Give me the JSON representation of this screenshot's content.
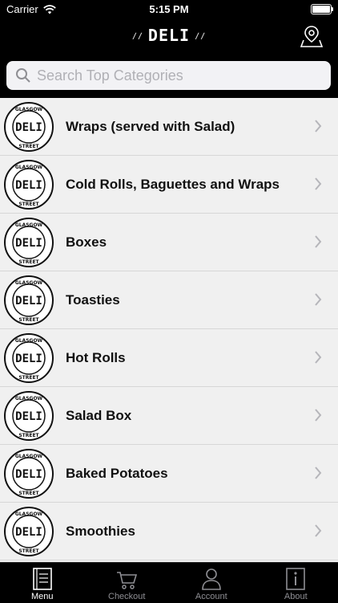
{
  "status_bar": {
    "carrier": "Carrier",
    "time": "5:15 PM"
  },
  "header": {
    "logo_text": "DELI",
    "map_icon": "map-pin-icon"
  },
  "search": {
    "placeholder": "Search Top Categories"
  },
  "badge": {
    "top_text": "GLASGOW",
    "center_text": "DELI",
    "bottom_text": "STREET"
  },
  "categories": [
    {
      "label": "Wraps (served with Salad)"
    },
    {
      "label": "Cold Rolls, Baguettes and Wraps"
    },
    {
      "label": "Boxes"
    },
    {
      "label": "Toasties"
    },
    {
      "label": "Hot Rolls"
    },
    {
      "label": "Salad Box"
    },
    {
      "label": "Baked Potatoes"
    },
    {
      "label": "Smoothies"
    }
  ],
  "tabs": [
    {
      "label": "Menu",
      "icon": "menu-book-icon",
      "active": true
    },
    {
      "label": "Checkout",
      "icon": "cart-icon",
      "active": false
    },
    {
      "label": "Account",
      "icon": "person-icon",
      "active": false
    },
    {
      "label": "About",
      "icon": "info-icon",
      "active": false
    }
  ]
}
